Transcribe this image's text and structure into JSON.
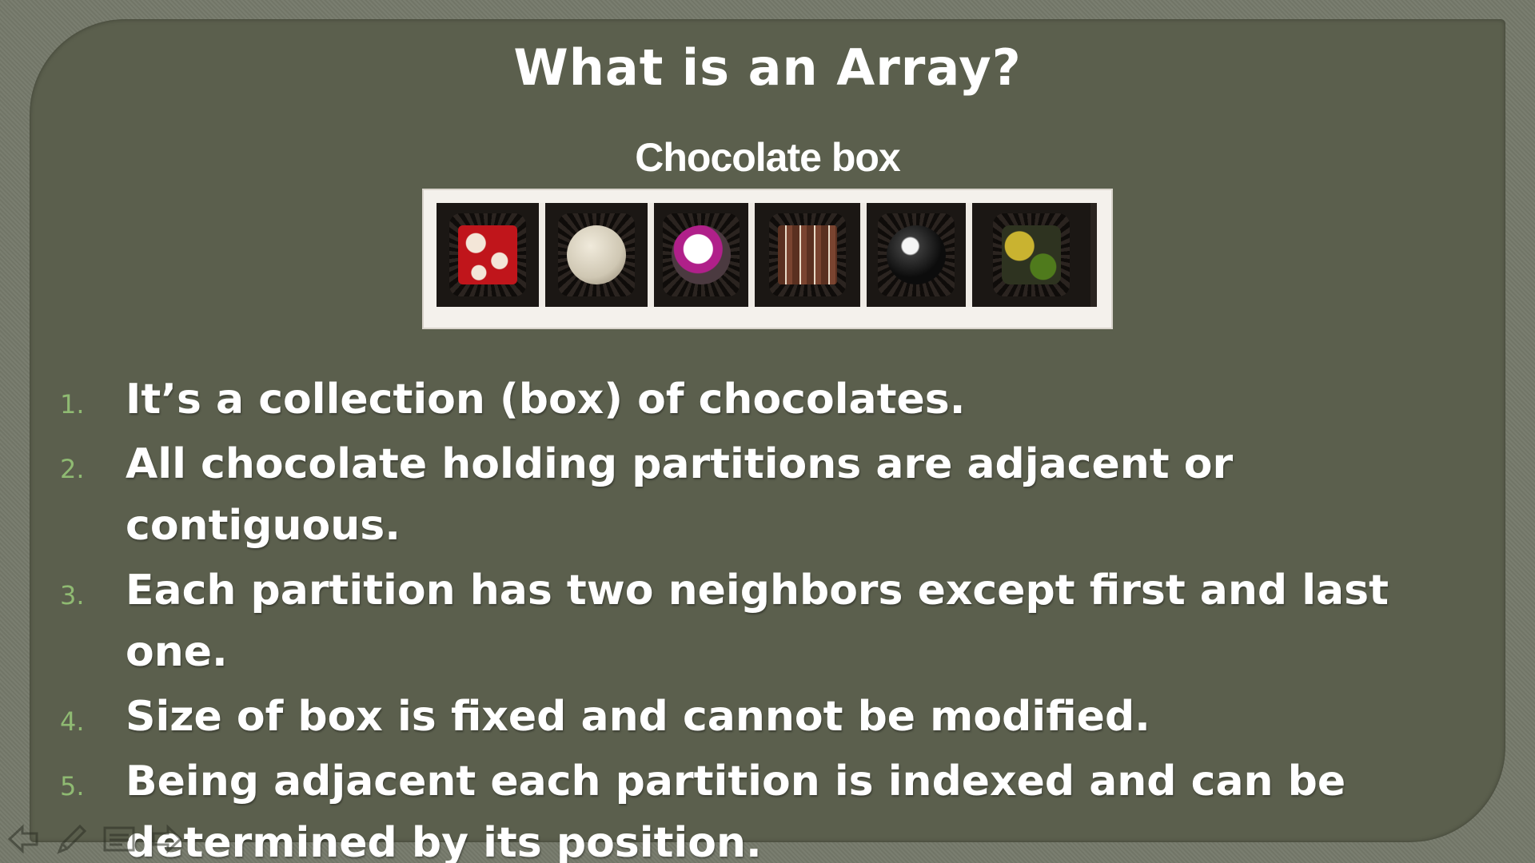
{
  "slide": {
    "title": "What is an Array?",
    "subtitle": "Chocolate box",
    "points": [
      {
        "number": "1.",
        "text": "It’s a collection (box) of chocolates."
      },
      {
        "number": "2.",
        "text": "All chocolate holding partitions are adjacent or contiguous."
      },
      {
        "number": "3.",
        "text": "Each partition has two neighbors except first and last one."
      },
      {
        "number": "4.",
        "text": "Size of box is fixed and cannot be modified."
      },
      {
        "number": "5.",
        "text": "Being adjacent each partition is indexed and can be determined by its position."
      }
    ]
  },
  "toolbar": {
    "icons": [
      "arrow-left-icon",
      "pen-icon",
      "menu-icon",
      "arrow-right-icon"
    ]
  },
  "colors": {
    "slide_background": "#5b5f4d",
    "outer_background": "#75796a",
    "list_number": "#8fba72",
    "text": "#ffffff"
  }
}
